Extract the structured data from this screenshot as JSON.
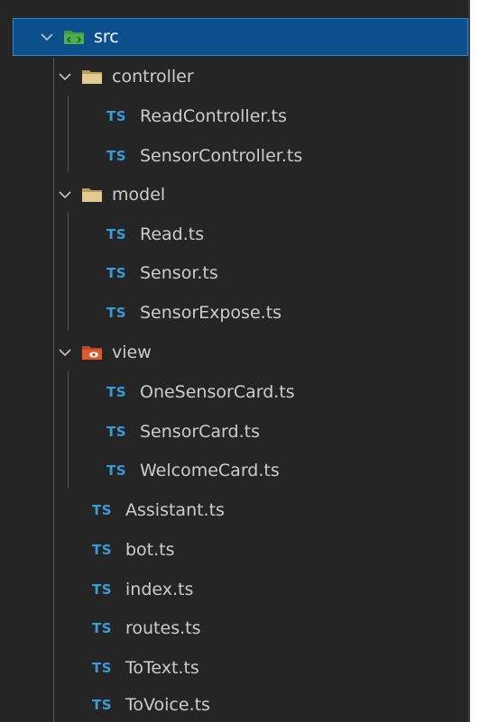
{
  "explorer": {
    "src": {
      "label": "src",
      "expanded": true,
      "icon": "folder-src-icon"
    },
    "controller": {
      "label": "controller",
      "expanded": true,
      "icon": "folder-icon",
      "files": [
        {
          "label": "ReadController.ts",
          "badge": "TS"
        },
        {
          "label": "SensorController.ts",
          "badge": "TS"
        }
      ]
    },
    "model": {
      "label": "model",
      "expanded": true,
      "icon": "folder-icon",
      "files": [
        {
          "label": "Read.ts",
          "badge": "TS"
        },
        {
          "label": "Sensor.ts",
          "badge": "TS"
        },
        {
          "label": "SensorExpose.ts",
          "badge": "TS"
        }
      ]
    },
    "view": {
      "label": "view",
      "expanded": true,
      "icon": "folder-view-icon",
      "files": [
        {
          "label": "OneSensorCard.ts",
          "badge": "TS"
        },
        {
          "label": "SensorCard.ts",
          "badge": "TS"
        },
        {
          "label": "WelcomeCard.ts",
          "badge": "TS"
        }
      ]
    },
    "root_files": [
      {
        "label": "Assistant.ts",
        "badge": "TS"
      },
      {
        "label": "bot.ts",
        "badge": "TS"
      },
      {
        "label": "index.ts",
        "badge": "TS"
      },
      {
        "label": "routes.ts",
        "badge": "TS"
      },
      {
        "label": "ToText.ts",
        "badge": "TS"
      },
      {
        "label": "ToVoice.ts",
        "badge": "TS"
      }
    ],
    "colors": {
      "background": "#252526",
      "selection": "#0b4f8c",
      "selection_border": "#2f84d6",
      "text": "#cccccc",
      "ts_badge": "#3b9cd8",
      "folder": "#d9c28a",
      "src_folder": "#4caf50",
      "view_folder": "#e05a2b"
    }
  }
}
